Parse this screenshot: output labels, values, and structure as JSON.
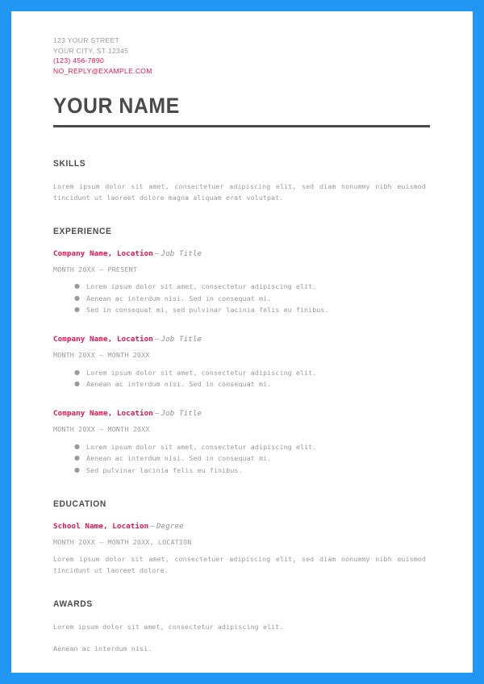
{
  "theme": {
    "frame_color": "#2196f3",
    "page_color": "#ffffff",
    "accent_color": "#e8134e",
    "heading_color": "#4a4a4a",
    "body_color": "#9a9a9a"
  },
  "contact": {
    "street": "123 YOUR STREET",
    "city_state_zip": "YOUR CITY, ST 12345",
    "phone": "(123) 456-7890",
    "email": "NO_REPLY@EXAMPLE.COM"
  },
  "name": "YOUR NAME",
  "sections": {
    "skills": {
      "heading": "SKILLS",
      "paragraph": "Lorem ipsum dolor sit amet, consectetuer adipiscing elit, sed diam nonummy nibh euismod tincidunt ut laoreet dolore magna aliquam erat volutpat."
    },
    "experience": {
      "heading": "EXPERIENCE",
      "entries": [
        {
          "org": "Company Name, Location",
          "dash": "—",
          "role": "Job Title",
          "dates": "MONTH 20XX – PRESENT",
          "bullets": [
            "Lorem ipsum dolor sit amet, consectetur adipiscing elit.",
            "Aenean ac interdum nisi. Sed in consequat mi.",
            "Sed in consequat mi, sed pulvinar lacinia felis eu finibus."
          ]
        },
        {
          "org": "Company Name, Location",
          "dash": "—",
          "role": "Job Title",
          "dates": "MONTH 20XX – MONTH 20XX",
          "bullets": [
            "Lorem ipsum dolor sit amet, consectetur adipiscing elit.",
            "Aenean ac interdum nisi. Sed in consequat mi."
          ]
        },
        {
          "org": "Company Name, Location",
          "dash": "—",
          "role": "Job Title",
          "dates": "MONTH 20XX – MONTH 20XX",
          "bullets": [
            "Lorem ipsum dolor sit amet, consectetur adipiscing elit.",
            "Aenean ac interdum nisi. Sed in consequat mi.",
            "Sed pulvinar lacinia felis eu finibus."
          ]
        }
      ]
    },
    "education": {
      "heading": "EDUCATION",
      "entry": {
        "org": "School Name, Location",
        "dash": "—",
        "role": "Degree",
        "dates": "MONTH 20XX – MONTH 20XX, LOCATION",
        "paragraph": "Lorem ipsum dolor sit amet, consectetuer adipiscing elit, sed diam nonummy nibh euismod tincidunt ut laoreet dolore."
      }
    },
    "awards": {
      "heading": "AWARDS",
      "lines": [
        "Lorem ipsum dolor sit amet, consectetur adipiscing elit.",
        "Aenean ac interdum nisi."
      ]
    }
  },
  "bullet_glyph": "●"
}
